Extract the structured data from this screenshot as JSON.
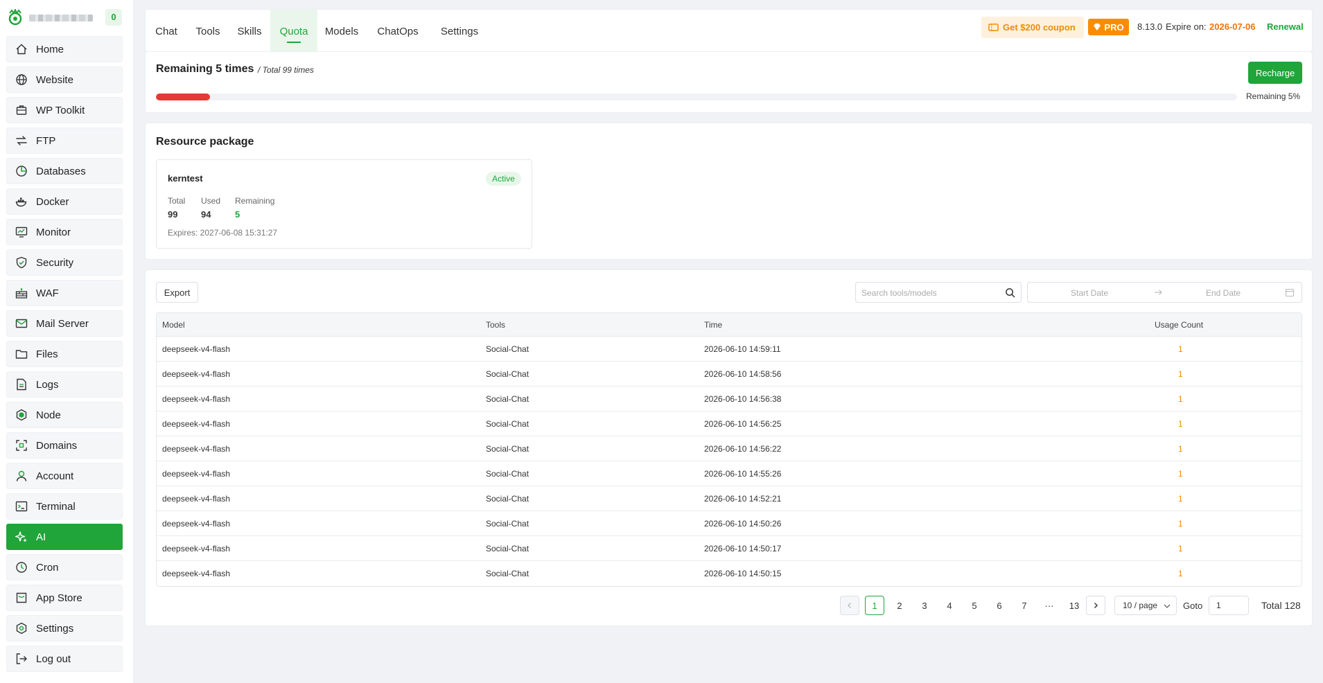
{
  "sidebar": {
    "badge": "0",
    "items": [
      {
        "label": "Home",
        "icon": "home-icon"
      },
      {
        "label": "Website",
        "icon": "globe-icon"
      },
      {
        "label": "WP Toolkit",
        "icon": "wp-toolkit-icon"
      },
      {
        "label": "FTP",
        "icon": "transfer-icon"
      },
      {
        "label": "Databases",
        "icon": "database-icon"
      },
      {
        "label": "Docker",
        "icon": "docker-icon"
      },
      {
        "label": "Monitor",
        "icon": "monitor-icon"
      },
      {
        "label": "Security",
        "icon": "shield-icon"
      },
      {
        "label": "WAF",
        "icon": "firewall-icon"
      },
      {
        "label": "Mail Server",
        "icon": "mail-icon"
      },
      {
        "label": "Files",
        "icon": "folder-icon"
      },
      {
        "label": "Logs",
        "icon": "log-icon"
      },
      {
        "label": "Node",
        "icon": "node-icon"
      },
      {
        "label": "Domains",
        "icon": "domain-icon"
      },
      {
        "label": "Account",
        "icon": "user-icon"
      },
      {
        "label": "Terminal",
        "icon": "terminal-icon"
      },
      {
        "label": "AI",
        "icon": "sparkle-icon",
        "active": true
      },
      {
        "label": "Cron",
        "icon": "clock-icon"
      },
      {
        "label": "App Store",
        "icon": "store-icon"
      },
      {
        "label": "Settings",
        "icon": "gear-icon"
      },
      {
        "label": "Log out",
        "icon": "logout-icon"
      }
    ]
  },
  "topbar": {
    "tabs": [
      "Chat",
      "Tools",
      "Skills",
      "Quota",
      "Models",
      "ChatOps",
      "Settings"
    ],
    "active_tab": "Quota",
    "coupon": "Get $200 coupon",
    "pro": "PRO",
    "version": "8.13.0",
    "expire_label": "Expire on:",
    "expire_date": "2026-07-06",
    "renewal": "Renewal"
  },
  "quota": {
    "title": "Remaining 5 times",
    "subtitle": "/ Total 99 times",
    "recharge": "Recharge",
    "remaining_fraction": 0.05,
    "remaining_pct_label": "Remaining 5%"
  },
  "resource": {
    "title": "Resource package",
    "package": {
      "name": "kerntest",
      "status": "Active",
      "total_label": "Total",
      "total": "99",
      "used_label": "Used",
      "used": "94",
      "remaining_label": "Remaining",
      "remaining": "5",
      "expires": "Expires: 2027-06-08 15:31:27"
    }
  },
  "usage": {
    "export": "Export",
    "search_placeholder": "Search tools/models",
    "start_date_placeholder": "Start Date",
    "end_date_placeholder": "End Date",
    "columns": [
      "Model",
      "Tools",
      "Time",
      "Usage Count"
    ],
    "rows": [
      {
        "model": "deepseek-v4-flash",
        "tool": "Social-Chat",
        "time": "2026-06-10 14:59:11",
        "count": "1"
      },
      {
        "model": "deepseek-v4-flash",
        "tool": "Social-Chat",
        "time": "2026-06-10 14:58:56",
        "count": "1"
      },
      {
        "model": "deepseek-v4-flash",
        "tool": "Social-Chat",
        "time": "2026-06-10 14:56:38",
        "count": "1"
      },
      {
        "model": "deepseek-v4-flash",
        "tool": "Social-Chat",
        "time": "2026-06-10 14:56:25",
        "count": "1"
      },
      {
        "model": "deepseek-v4-flash",
        "tool": "Social-Chat",
        "time": "2026-06-10 14:56:22",
        "count": "1"
      },
      {
        "model": "deepseek-v4-flash",
        "tool": "Social-Chat",
        "time": "2026-06-10 14:55:26",
        "count": "1"
      },
      {
        "model": "deepseek-v4-flash",
        "tool": "Social-Chat",
        "time": "2026-06-10 14:52:21",
        "count": "1"
      },
      {
        "model": "deepseek-v4-flash",
        "tool": "Social-Chat",
        "time": "2026-06-10 14:50:26",
        "count": "1"
      },
      {
        "model": "deepseek-v4-flash",
        "tool": "Social-Chat",
        "time": "2026-06-10 14:50:17",
        "count": "1"
      },
      {
        "model": "deepseek-v4-flash",
        "tool": "Social-Chat",
        "time": "2026-06-10 14:50:15",
        "count": "1"
      }
    ]
  },
  "pagination": {
    "pages": [
      "1",
      "2",
      "3",
      "4",
      "5",
      "6",
      "7",
      "···",
      "13"
    ],
    "current": "1",
    "page_size": "10 / page",
    "goto_label": "Goto",
    "goto_value": "1",
    "total": "Total 128"
  },
  "colors": {
    "accent": "#20a53a",
    "warning": "#f08c00",
    "danger": "#e53935"
  }
}
